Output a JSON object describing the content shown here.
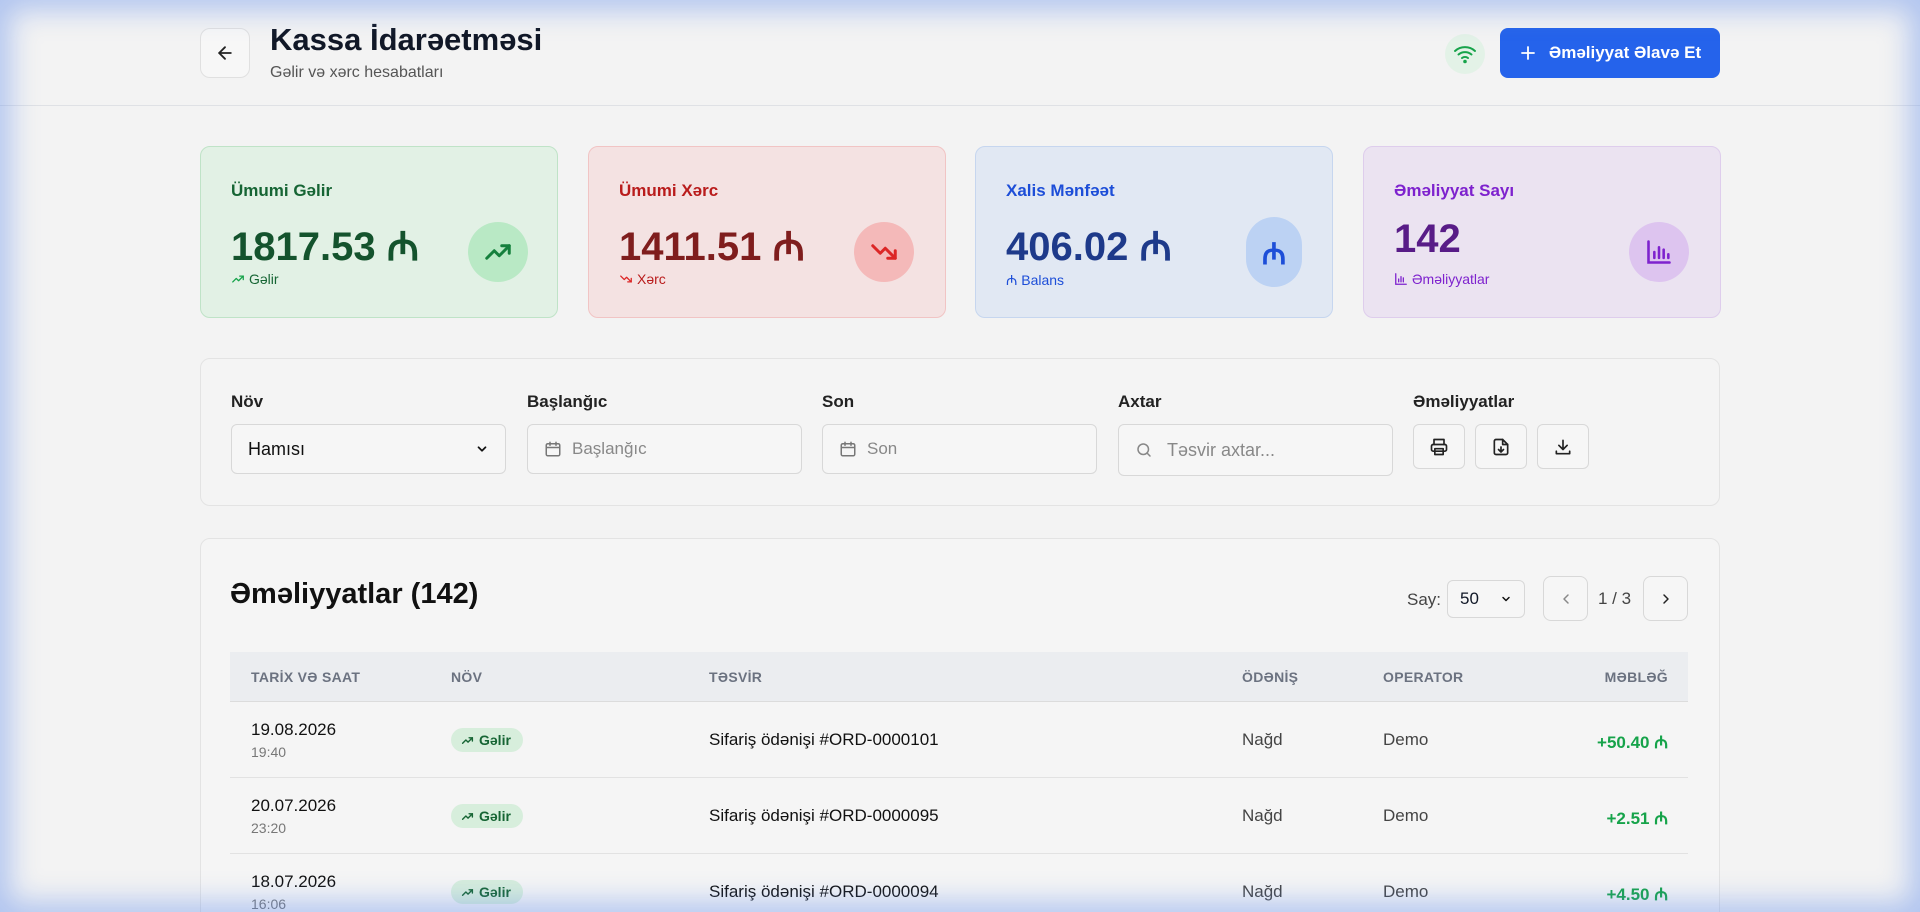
{
  "header": {
    "title": "Kassa İdarəetməsi",
    "subtitle": "Gəlir və xərc hesabatları",
    "add_label": "Əməliyyat Əlavə Et",
    "wifi_color": "#16a34a",
    "accent": "#2563eb"
  },
  "stats": {
    "income": {
      "label": "Ümumi Gəlir",
      "value": "1817.53 ₼",
      "sub": "Gəlir"
    },
    "expense": {
      "label": "Ümumi Xərc",
      "value": "1411.51 ₼",
      "sub": "Xərc"
    },
    "profit": {
      "label": "Xalis Mənfəət",
      "value": "406.02 ₼",
      "sub": "₼ Balans",
      "icon_glyph": "₼"
    },
    "count": {
      "label": "Əməliyyat Sayı",
      "value": "142",
      "sub": "Əməliyyatlar"
    }
  },
  "filters": {
    "type_label": "Növ",
    "type_value": "Hamısı",
    "start_label": "Başlanğıc",
    "start_placeholder": "Başlanğıc",
    "end_label": "Son",
    "end_placeholder": "Son",
    "search_label": "Axtar",
    "search_placeholder": "Təsvir axtar...",
    "actions_label": "Əməliyyatlar"
  },
  "table": {
    "title": "Əməliyyatlar (142)",
    "per_page_label": "Say:",
    "per_page_value": "50",
    "page_info": "1 / 3",
    "columns": [
      "TARİX VƏ SAAT",
      "NÖV",
      "TƏSVİR",
      "ÖDƏNİŞ",
      "OPERATOR",
      "MƏBLƏĞ"
    ],
    "rows": [
      {
        "date": "19.08.2026",
        "time": "19:40",
        "type": "Gəlir",
        "desc": "Sifariş ödənişi #ORD-0000101",
        "payment": "Nağd",
        "operator": "Demo",
        "amount": "+50.40 ₼"
      },
      {
        "date": "20.07.2026",
        "time": "23:20",
        "type": "Gəlir",
        "desc": "Sifariş ödənişi #ORD-0000095",
        "payment": "Nağd",
        "operator": "Demo",
        "amount": "+2.51 ₼"
      },
      {
        "date": "18.07.2026",
        "time": "16:06",
        "type": "Gəlir",
        "desc": "Sifariş ödənişi #ORD-0000094",
        "payment": "Nağd",
        "operator": "Demo",
        "amount": "+4.50 ₼"
      }
    ]
  }
}
